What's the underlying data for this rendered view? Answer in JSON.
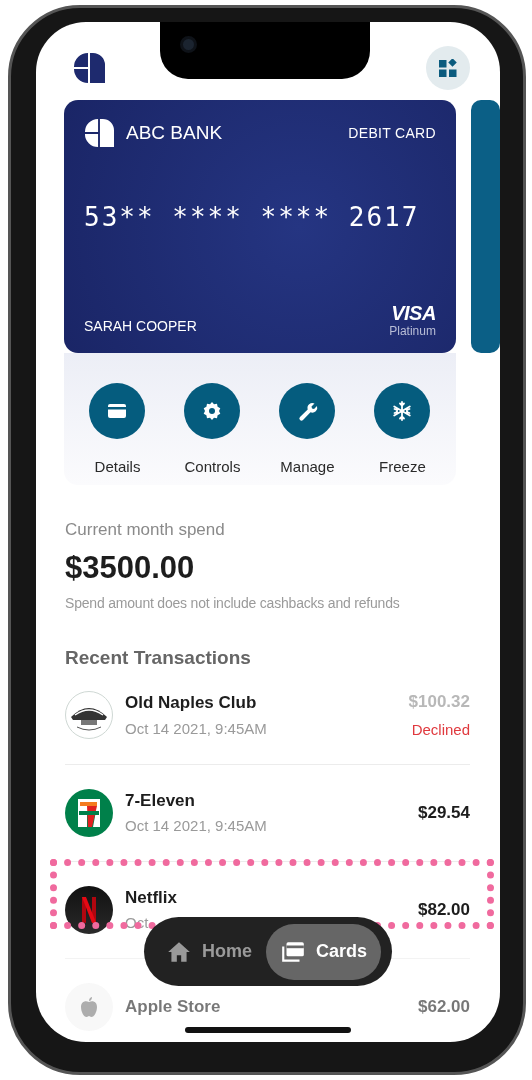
{
  "card": {
    "bank": "ABC BANK",
    "type": "DEBIT CARD",
    "number": "53** **** **** 2617",
    "holder": "SARAH COOPER",
    "network": "VISA",
    "tier": "Platinum"
  },
  "actions": [
    {
      "kind": "details",
      "label": "Details"
    },
    {
      "kind": "controls",
      "label": "Controls"
    },
    {
      "kind": "manage",
      "label": "Manage"
    },
    {
      "kind": "freeze",
      "label": "Freeze"
    }
  ],
  "spend": {
    "label": "Current month spend",
    "amount": "$3500.00",
    "note": "Spend amount does not include cashbacks and refunds"
  },
  "transactions_title": "Recent Transactions",
  "transactions": [
    {
      "kind": "seal",
      "name": "Old Naples Club",
      "date": "Oct 14 2021, 9:45AM",
      "amount": "$100.32",
      "declined": true,
      "status": "Declined",
      "faded": false
    },
    {
      "kind": "seven-eleven",
      "name": "7-Eleven",
      "date": "Oct 14 2021, 9:45AM",
      "amount": "$29.54",
      "declined": false,
      "faded": false
    },
    {
      "kind": "netflix",
      "name": "Netflix",
      "date": "Oct",
      "amount": "$82.00",
      "declined": false,
      "faded": false
    },
    {
      "kind": "apple",
      "name": "Apple Store",
      "amount": "$62.00",
      "declined": false,
      "faded": true
    }
  ],
  "nav": [
    {
      "kind": "home",
      "label": "Home",
      "selected": false
    },
    {
      "kind": "cards",
      "label": "Cards",
      "selected": true
    }
  ]
}
